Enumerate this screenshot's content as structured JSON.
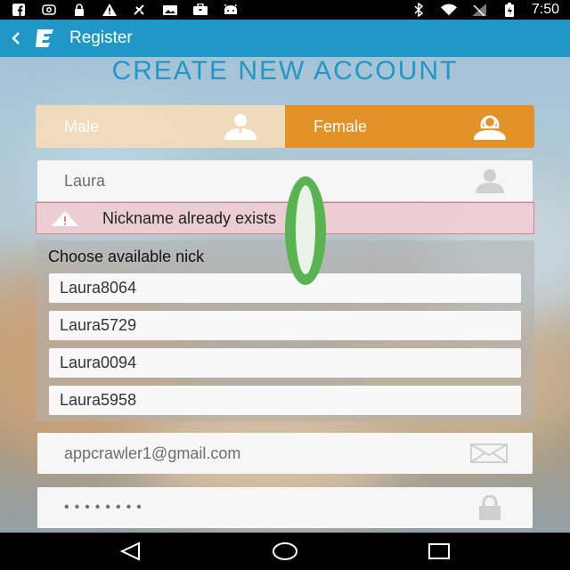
{
  "status_bar": {
    "time": "7:50",
    "left_icons": [
      "facebook-icon",
      "instagram-icon",
      "lock-icon",
      "warning-icon",
      "satellite-icon",
      "photo-icon",
      "briefcase-icon",
      "android-icon"
    ],
    "right_icons": [
      "bluetooth-icon",
      "wifi-icon",
      "signal-icon",
      "battery-icon"
    ]
  },
  "action_bar": {
    "title": "Register",
    "color": "#1f98c8"
  },
  "page": {
    "title": "CREATE NEW ACCOUNT"
  },
  "gender": {
    "male_label": "Male",
    "female_label": "Female",
    "selected": "Female",
    "selected_color": "#e39229"
  },
  "nickname": {
    "value": "Laura",
    "icon": "person-icon"
  },
  "error": {
    "message": "Nickname already exists",
    "icon": "warning-icon"
  },
  "suggestions": {
    "label": "Choose available nick",
    "items": [
      "Laura8064",
      "Laura5729",
      "Laura0094",
      "Laura5958"
    ]
  },
  "email": {
    "value": "appcrawler1@gmail.com",
    "icon": "envelope-icon"
  },
  "password": {
    "value": "••••••••",
    "icon": "lock-icon"
  },
  "nav_bar": {
    "buttons": [
      "back-triangle-icon",
      "home-circle-icon",
      "recents-square-icon"
    ]
  }
}
